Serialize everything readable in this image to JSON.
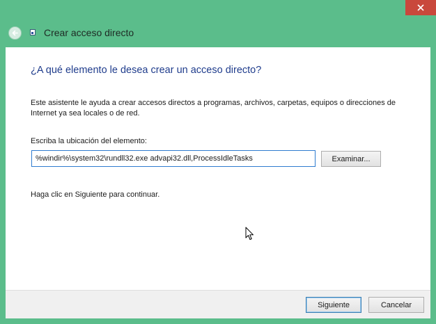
{
  "window": {
    "title": "Crear acceso directo"
  },
  "wizard": {
    "heading": "¿A qué elemento le desea crear un acceso directo?",
    "description": "Este asistente le ayuda a crear accesos directos a programas, archivos, carpetas, equipos o direcciones de Internet ya sea locales o de red.",
    "location_label": "Escriba la ubicación del elemento:",
    "location_value": "%windir%\\system32\\rundll32.exe advapi32.dll,ProcessIdleTasks",
    "browse_label": "Examinar...",
    "hint": "Haga clic en Siguiente para continuar."
  },
  "footer": {
    "next_label": "Siguiente",
    "cancel_label": "Cancelar"
  },
  "icons": {
    "close": "close-icon",
    "back": "back-arrow-icon",
    "shortcut": "shortcut-icon",
    "cursor": "mouse-cursor-icon"
  },
  "colors": {
    "window_frame": "#5bbd8b",
    "close_button": "#c9483c",
    "heading_text": "#1f3c8c",
    "input_border": "#2e7bcf",
    "footer_bg": "#f0f0f0"
  }
}
